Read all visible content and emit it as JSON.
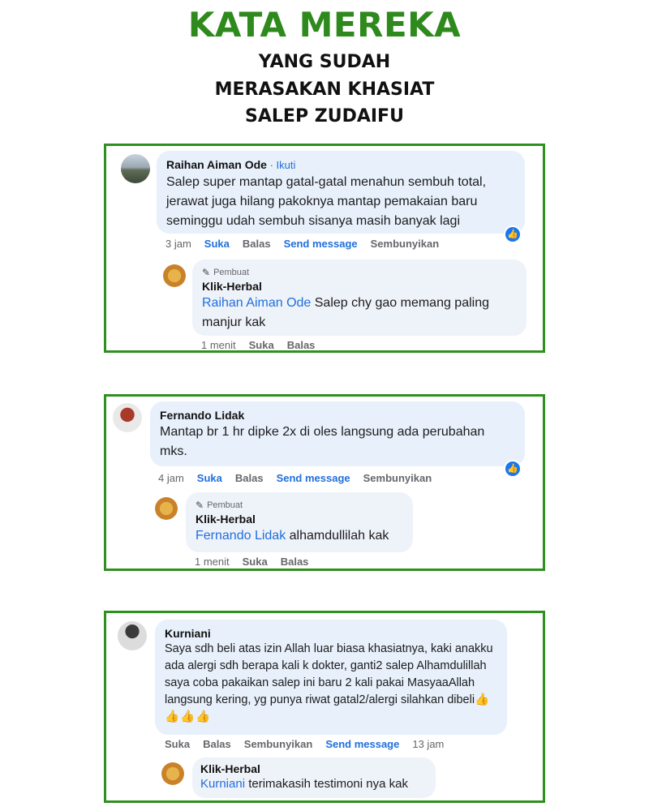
{
  "header": {
    "title": "KATA MEREKA",
    "line1": "YANG SUDAH",
    "line2": "MERASAKAN KHASIAT",
    "line3": "SALEP ZUDAIFU"
  },
  "colors": {
    "accent_green": "#2e8a1c",
    "frame_green": "#2f8f1f",
    "link_blue": "#216fdb",
    "like_blue": "#1877f2"
  },
  "comments": [
    {
      "author": "Raihan Aiman Ode",
      "separator": " · ",
      "follow_label": "Ikuti",
      "text": "Salep super mantap gatal-gatal menahun sembuh total, jerawat juga hilang pakoknya mantap pemakaian baru seminggu udah sembuh sisanya masih banyak lagi",
      "actions": {
        "time": "3 jam",
        "like": "Suka",
        "reply": "Balas",
        "message": "Send message",
        "hide": "Sembunyikan"
      },
      "reaction_icon": "like-icon",
      "reply": {
        "author_tag": "Pembuat",
        "author": "Klik-Herbal",
        "mention": "Raihan Aiman Ode",
        "text": " Salep chy gao memang paling manjur kak",
        "actions": {
          "time": "1 menit",
          "like": "Suka",
          "reply": "Balas"
        }
      }
    },
    {
      "author": "Fernando Lidak",
      "text": "Mantap br 1 hr dipke 2x di oles langsung ada perubahan mks.",
      "actions": {
        "time": "4 jam",
        "like": "Suka",
        "reply": "Balas",
        "message": "Send message",
        "hide": "Sembunyikan"
      },
      "reaction_icon": "like-icon",
      "reply": {
        "author_tag": "Pembuat",
        "author": "Klik-Herbal",
        "mention": "Fernando Lidak",
        "text": " alhamdullilah kak",
        "actions": {
          "time": "1 menit",
          "like": "Suka",
          "reply": "Balas"
        }
      }
    },
    {
      "author": "Kurniani",
      "text": "Saya sdh beli atas izin Allah luar biasa khasiatnya, kaki anakku ada alergi sdh berapa kali k dokter, ganti2 salep Alhamdulillah saya coba pakaikan salep ini baru 2 kali pakai MasyaaAllah langsung kering, yg punya riwat gatal2/alergi silahkan dibeli",
      "emoji": "👍👍👍👍",
      "actions": {
        "like": "Suka",
        "reply": "Balas",
        "hide": "Sembunyikan",
        "message": "Send message",
        "time": "13 jam"
      },
      "reply": {
        "author": "Klik-Herbal",
        "mention": "Kurniani",
        "text": " terimakasih testimoni nya kak"
      }
    }
  ]
}
